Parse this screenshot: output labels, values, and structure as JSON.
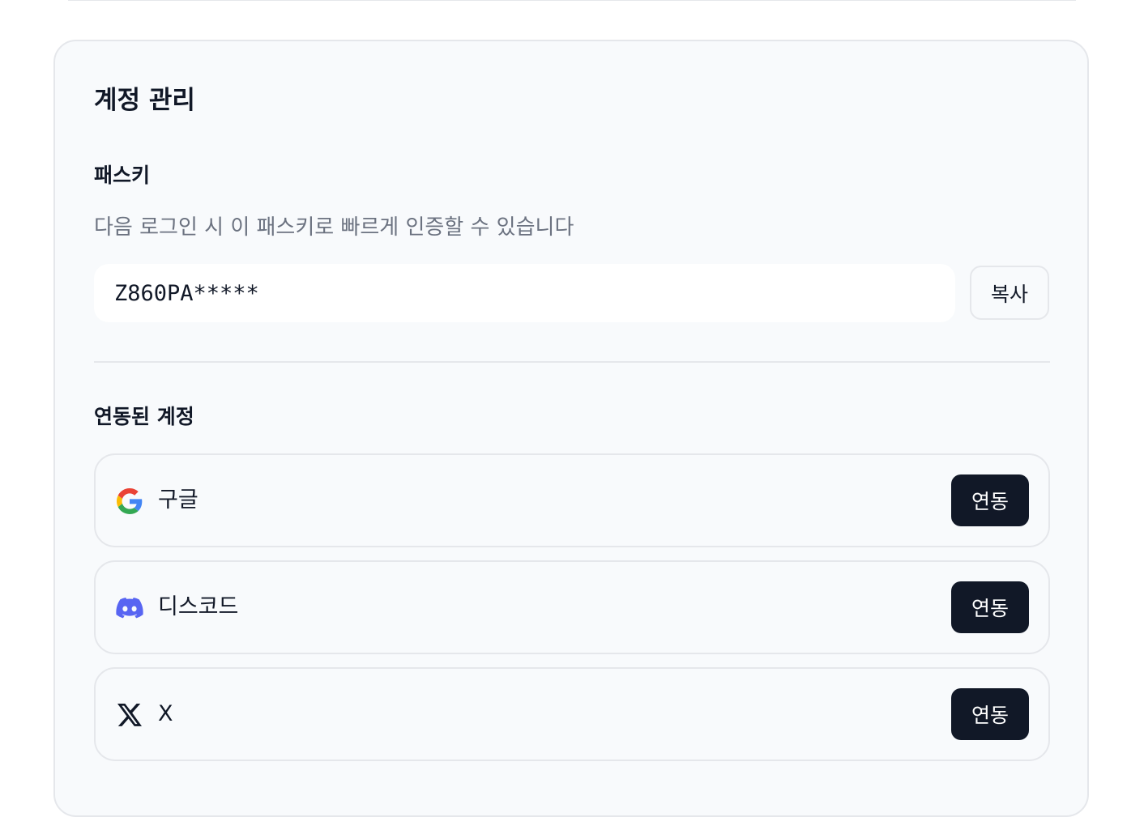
{
  "account_settings": {
    "title": "계정 관리",
    "passkey": {
      "label": "패스키",
      "description": "다음 로그인 시 이 패스키로 빠르게 인증할 수 있습니다",
      "value": "Z860PA*****",
      "copy_label": "복사"
    },
    "linked_accounts": {
      "label": "연동된 계정",
      "items": [
        {
          "name": "구글",
          "icon": "google-icon",
          "action_label": "연동"
        },
        {
          "name": "디스코드",
          "icon": "discord-icon",
          "action_label": "연동"
        },
        {
          "name": "X",
          "icon": "x-logo-icon",
          "action_label": "연동"
        }
      ]
    }
  },
  "colors": {
    "card_background": "#f8fafc",
    "border": "#e5e7eb",
    "primary_button": "#111827",
    "muted_text": "#6b7280",
    "discord_brand": "#5865f2"
  }
}
